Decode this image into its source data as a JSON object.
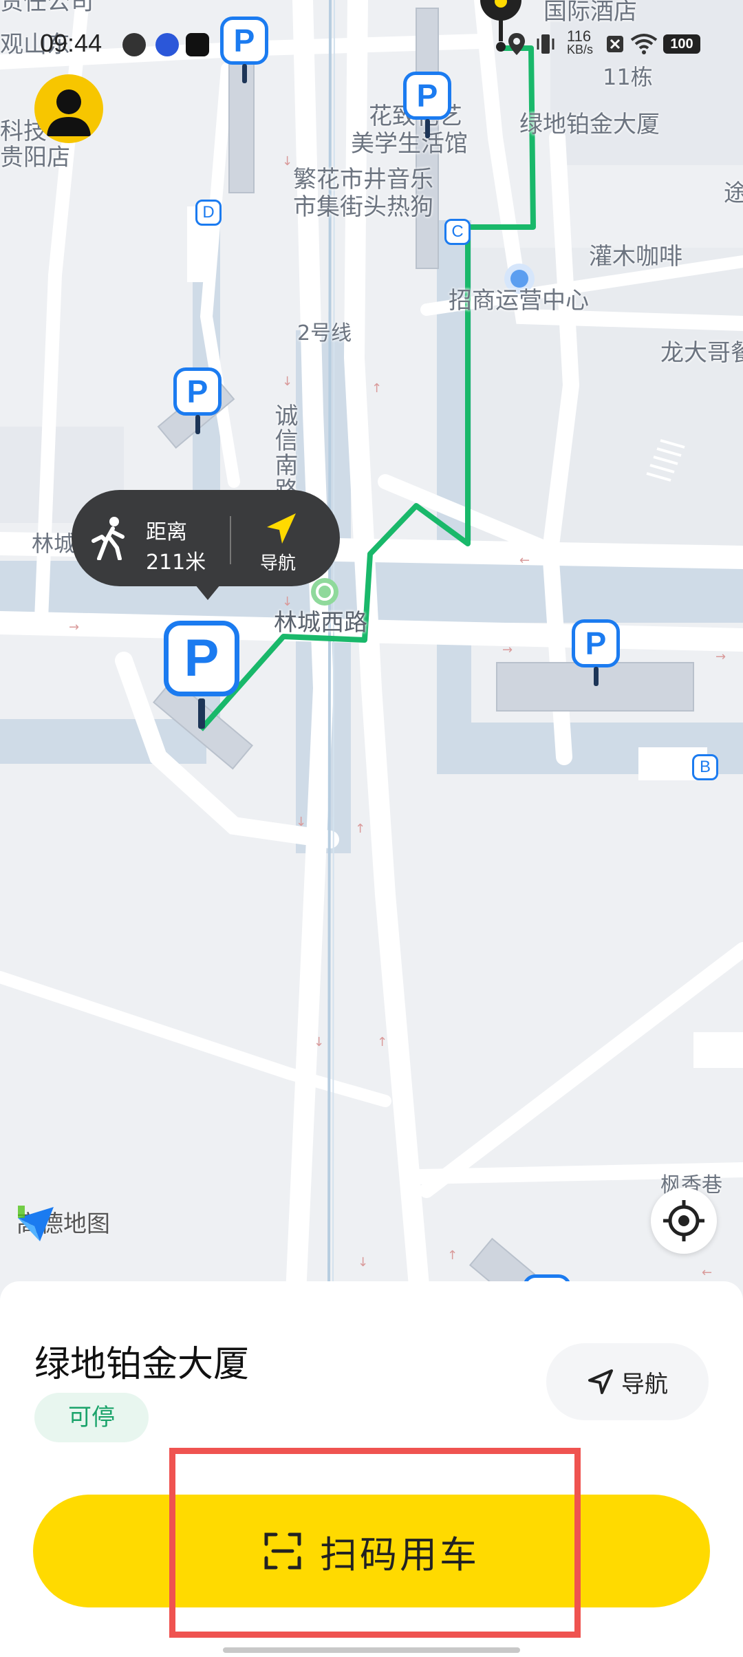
{
  "status_bar": {
    "time": "09:44",
    "net_speed_value": "116",
    "net_speed_unit": "KB/s",
    "battery": "100"
  },
  "map": {
    "labels": {
      "hotel": "国际酒店",
      "building_11": "11栋",
      "lvdi": "绿地铂金大厦",
      "huazhi": "花致花艺",
      "meixue": "美学生活馆",
      "fanhua1": "繁花市井音乐",
      "fanhua2": "市集街头热狗",
      "guanmu": "灌木咖啡",
      "zhaoshang": "招商运营中心",
      "longda": "龙大哥餐",
      "line2": "2号线",
      "chengxin": "诚信南路",
      "lincheng_w": "林城西路",
      "lincheng_left": "林城西路",
      "fengxiang": "枫香巷",
      "keji1": "科技",
      "guiyang": "贵阳店",
      "zeren": "责任公司",
      "guanshan": "观山东",
      "tu": "途"
    },
    "entries": [
      "D",
      "C",
      "B"
    ],
    "parking_letter": "P",
    "logo_text": "高德地图"
  },
  "bubble": {
    "distance_label": "距离",
    "distance_value": "211米",
    "nav_label": "导航"
  },
  "card": {
    "place_name": "绿地铂金大厦",
    "status": "可停",
    "nav_button": "导航",
    "scan_button": "扫码用车"
  },
  "colors": {
    "route": "#19b86a",
    "parking": "#1b7bf0",
    "primary_yellow": "#ffda00",
    "highlight": "#ef5350"
  }
}
